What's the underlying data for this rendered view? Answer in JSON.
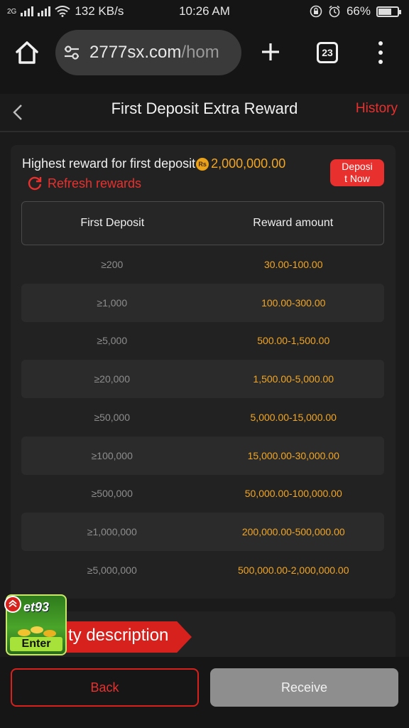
{
  "status_bar": {
    "network": "2G",
    "speed": "132 KB/s",
    "time": "10:26 AM",
    "battery": "66%",
    "battery_level": 0.66
  },
  "browser": {
    "url_main": "2777sx.com",
    "url_dim": "/hom",
    "tab_count": "23",
    "icons": [
      "home-icon",
      "site-settings-icon",
      "new-tab-icon",
      "tab-switcher-icon",
      "overflow-menu-icon"
    ]
  },
  "header": {
    "title": "First Deposit Extra Reward",
    "history": "History"
  },
  "reward": {
    "highest_label": "Highest reward for first deposit",
    "currency_symbol": "Rs",
    "highest_amount": "2,000,000.00",
    "refresh": "Refresh rewards",
    "deposit_now": "Deposi\nt Now",
    "table": {
      "col_deposit": "First Deposit",
      "col_reward": "Reward amount",
      "rows": [
        {
          "deposit": "≥200",
          "reward": "30.00-100.00"
        },
        {
          "deposit": "≥1,000",
          "reward": "100.00-300.00"
        },
        {
          "deposit": "≥5,000",
          "reward": "500.00-1,500.00"
        },
        {
          "deposit": "≥20,000",
          "reward": "1,500.00-5,000.00"
        },
        {
          "deposit": "≥50,000",
          "reward": "5,000.00-15,000.00"
        },
        {
          "deposit": "≥100,000",
          "reward": "15,000.00-30,000.00"
        },
        {
          "deposit": "≥500,000",
          "reward": "50,000.00-100,000.00"
        },
        {
          "deposit": "≥1,000,000",
          "reward": "200,000.00-500,000.00"
        },
        {
          "deposit": "≥5,000,000",
          "reward": "500,000.00-2,000,000.00"
        }
      ]
    }
  },
  "activity": {
    "title": "ty description"
  },
  "promo": {
    "brand": "et93",
    "enter": "Enter"
  },
  "footer": {
    "back": "Back",
    "receive": "Receive"
  },
  "colors": {
    "accent_red": "#e8312e",
    "reward_gold": "#f2a623",
    "background": "#1b1b1b",
    "disabled_button": "#8e8e8e"
  }
}
